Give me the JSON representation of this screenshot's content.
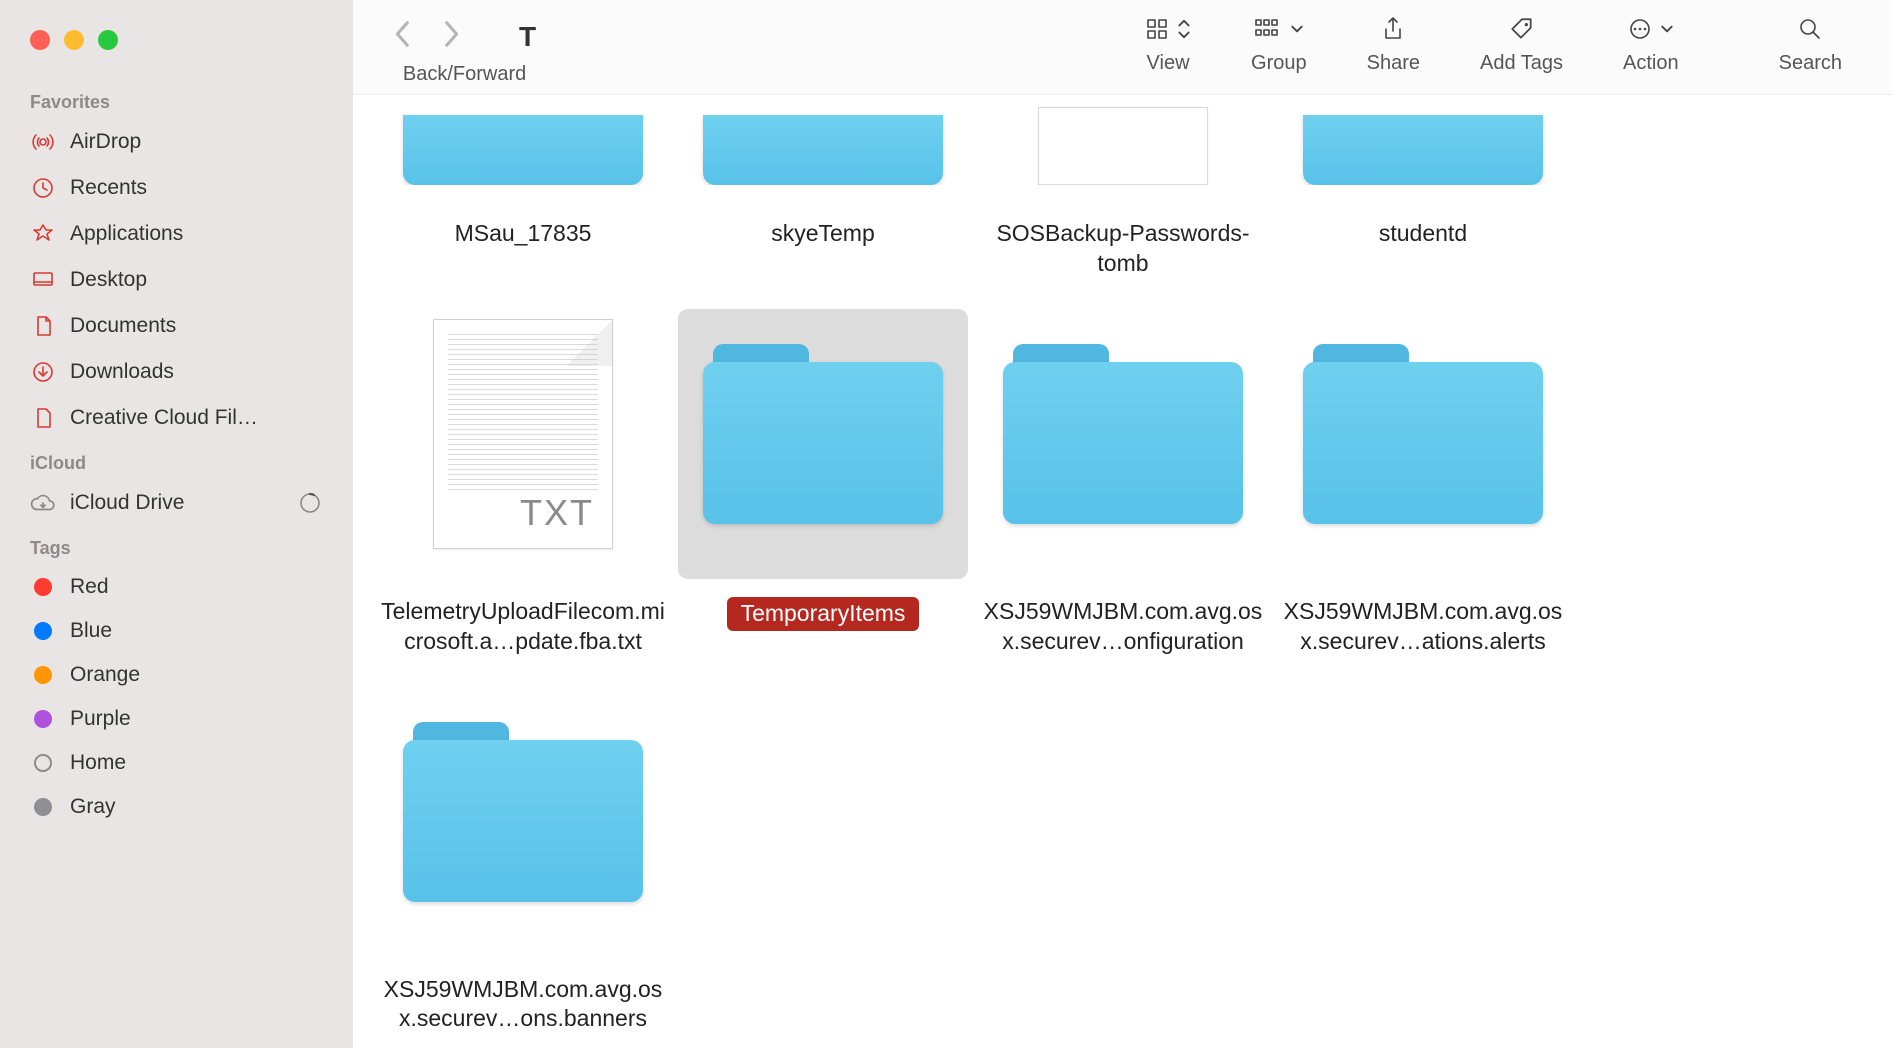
{
  "window_title": "T",
  "toolbar": {
    "back_forward_label": "Back/Forward",
    "view_label": "View",
    "group_label": "Group",
    "share_label": "Share",
    "add_tags_label": "Add Tags",
    "action_label": "Action",
    "search_label": "Search"
  },
  "sidebar": {
    "favorites": {
      "header": "Favorites",
      "items": [
        {
          "icon": "airdrop-icon",
          "label": "AirDrop"
        },
        {
          "icon": "recents-icon",
          "label": "Recents"
        },
        {
          "icon": "applications-icon",
          "label": "Applications"
        },
        {
          "icon": "desktop-icon",
          "label": "Desktop"
        },
        {
          "icon": "documents-icon",
          "label": "Documents"
        },
        {
          "icon": "downloads-icon",
          "label": "Downloads"
        },
        {
          "icon": "creative-cloud-icon",
          "label": "Creative Cloud Fil…"
        }
      ]
    },
    "icloud": {
      "header": "iCloud",
      "items": [
        {
          "icon": "icloud-drive-icon",
          "label": "iCloud Drive",
          "trailing": "progress"
        }
      ]
    },
    "tags": {
      "header": "Tags",
      "items": [
        {
          "color": "#ff3b30",
          "label": "Red"
        },
        {
          "color": "#007aff",
          "label": "Blue"
        },
        {
          "color": "#ff9500",
          "label": "Orange"
        },
        {
          "color": "#af52de",
          "label": "Purple"
        },
        {
          "color": "outline",
          "label": "Home"
        },
        {
          "color": "#8e8e93",
          "label": "Gray"
        }
      ]
    }
  },
  "items_row1": [
    {
      "type": "folder",
      "name": "MSau_17835"
    },
    {
      "type": "folder",
      "name": "skyeTemp"
    },
    {
      "type": "doc",
      "name": "SOSBackup-Passwords-tomb"
    },
    {
      "type": "folder",
      "name": "studentd"
    }
  ],
  "items_row2": [
    {
      "type": "txt",
      "name": "TelemetryUploadFilecom.microsoft.a…pdate.fba.txt",
      "ext": "TXT"
    },
    {
      "type": "folder",
      "name": "TemporaryItems",
      "selected": true
    },
    {
      "type": "folder",
      "name": "XSJ59WMJBM.com.avg.osx.securev…onfiguration"
    },
    {
      "type": "folder",
      "name": "XSJ59WMJBM.com.avg.osx.securev…ations.alerts"
    }
  ],
  "items_row3": [
    {
      "type": "folder",
      "name": "XSJ59WMJBM.com.avg.osx.securev…ons.banners"
    }
  ]
}
